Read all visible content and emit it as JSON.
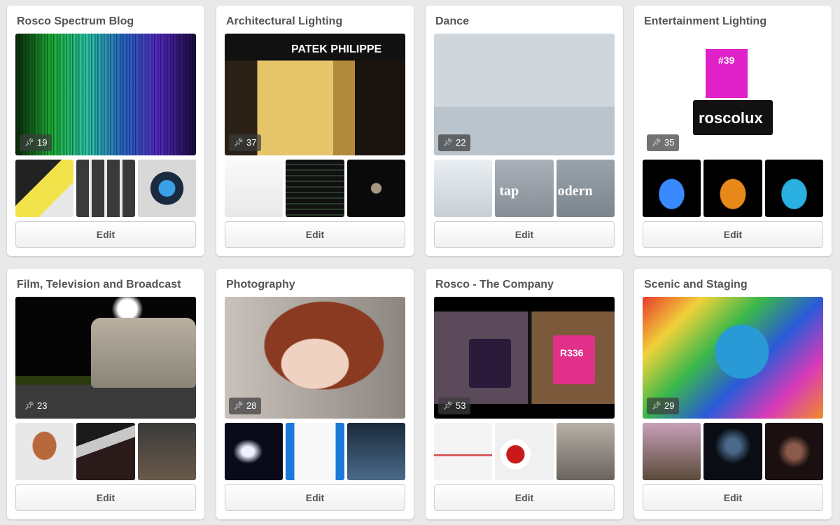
{
  "boards": [
    {
      "title": "Rosco Spectrum Blog",
      "pins": "19",
      "cover": "c-spectrum",
      "thumbs": [
        "t-a",
        "t-b",
        "t-c"
      ],
      "edit": "Edit"
    },
    {
      "title": "Architectural Lighting",
      "pins": "37",
      "cover": "c-arch",
      "thumbs": [
        "t-d",
        "t-e",
        "t-f"
      ],
      "edit": "Edit",
      "sign": "PATEK PHILIPPE"
    },
    {
      "title": "Dance",
      "pins": "22",
      "cover": "c-dance",
      "thumbs": [
        "t-g",
        "t-h",
        "t-i"
      ],
      "edit": "Edit",
      "thumb_words": [
        "tap",
        "odern"
      ]
    },
    {
      "title": "Entertainment Lighting",
      "pins": "35",
      "cover": "c-ent",
      "thumbs": [
        "t-j",
        "t-k",
        "t-l"
      ],
      "edit": "Edit",
      "logo": "roscolux",
      "swatch": "#39"
    },
    {
      "title": "Film, Television and Broadcast",
      "pins": "23",
      "cover": "c-film",
      "thumbs": [
        "t-m",
        "t-n",
        "t-o"
      ],
      "edit": "Edit"
    },
    {
      "title": "Photography",
      "pins": "28",
      "cover": "c-photo",
      "thumbs": [
        "t-p",
        "t-q",
        "t-r"
      ],
      "edit": "Edit"
    },
    {
      "title": "Rosco - The Company",
      "pins": "53",
      "cover": "c-company",
      "thumbs": [
        "t-s",
        "t-t",
        "t-u"
      ],
      "edit": "Edit",
      "mug_label": "R336"
    },
    {
      "title": "Scenic and Staging",
      "pins": "29",
      "cover": "c-scenic",
      "thumbs": [
        "t-v",
        "t-w",
        "t-x"
      ],
      "edit": "Edit"
    }
  ],
  "icons": {
    "pin": "pushpin-icon"
  }
}
